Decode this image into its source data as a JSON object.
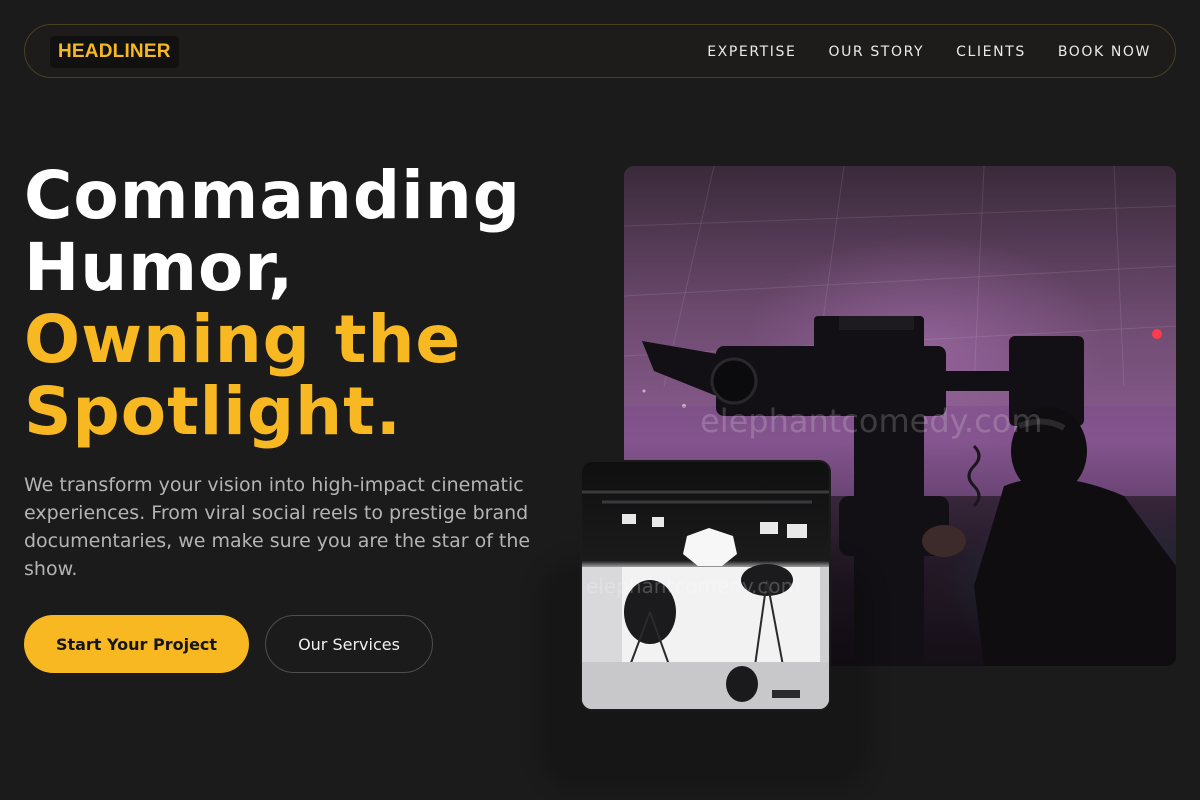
{
  "brand": {
    "logo": "HEADLINER",
    "accent": "#f7b821"
  },
  "nav": {
    "links": [
      {
        "label": "EXPERTISE"
      },
      {
        "label": "OUR STORY"
      },
      {
        "label": "CLIENTS"
      },
      {
        "label": "BOOK NOW"
      }
    ]
  },
  "hero": {
    "headline": {
      "line1": "Commanding",
      "line2": "Humor,",
      "line3": "Owning the",
      "line4": "Spotlight."
    },
    "lead": "We transform your vision into high-impact cinematic experiences. From viral social reels to prestige brand documentaries, we make sure you are the star of the show.",
    "primary_cta": "Start Your Project",
    "secondary_cta": "Our Services"
  },
  "media": {
    "main_photo": "camera-operator-photo",
    "inset_photo": "studio-lighting-photo",
    "watermark_main": "elephantcomedy.com",
    "watermark_inset": "elephantcomedy.com"
  }
}
